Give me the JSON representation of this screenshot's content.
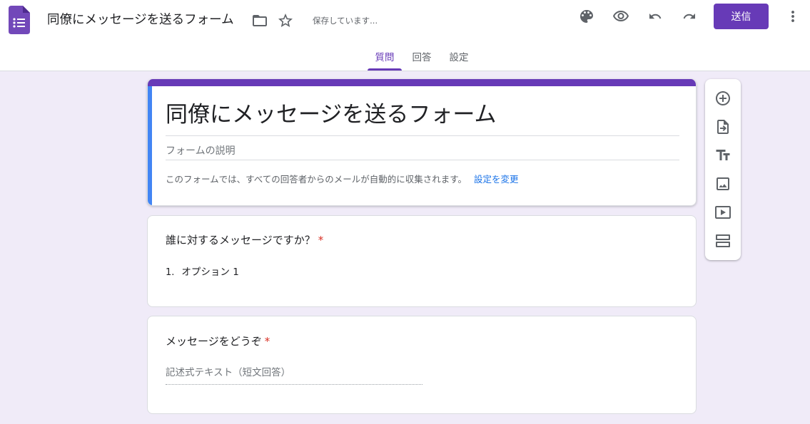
{
  "header": {
    "doc_title": "同僚にメッセージを送るフォーム",
    "save_status": "保存しています...",
    "send_label": "送信",
    "brand_color": "#673ab7",
    "icons": [
      "forms-logo-icon",
      "folder-icon",
      "star-icon",
      "palette-icon",
      "eye-icon",
      "undo-icon",
      "redo-icon",
      "more-vert-icon"
    ]
  },
  "tabs": [
    {
      "label": "質問",
      "active": true
    },
    {
      "label": "回答",
      "active": false
    },
    {
      "label": "設定",
      "active": false
    }
  ],
  "form": {
    "title": "同僚にメッセージを送るフォーム",
    "description_placeholder": "フォームの説明",
    "email_note": "このフォームでは、すべての回答者からのメールが自動的に収集されます。",
    "email_link": "設定を変更"
  },
  "questions": [
    {
      "title": "誰に対するメッセージですか？",
      "required_mark": "*",
      "option_number": "1.",
      "option_label": "オプション 1"
    },
    {
      "title": "メッセージをどうぞ",
      "required_mark": "*",
      "answer_placeholder": "記述式テキスト（短文回答）"
    }
  ],
  "toolbar": {
    "icons": [
      "add-question-icon",
      "import-questions-icon",
      "add-title-icon",
      "add-image-icon",
      "add-video-icon",
      "add-section-icon"
    ]
  }
}
